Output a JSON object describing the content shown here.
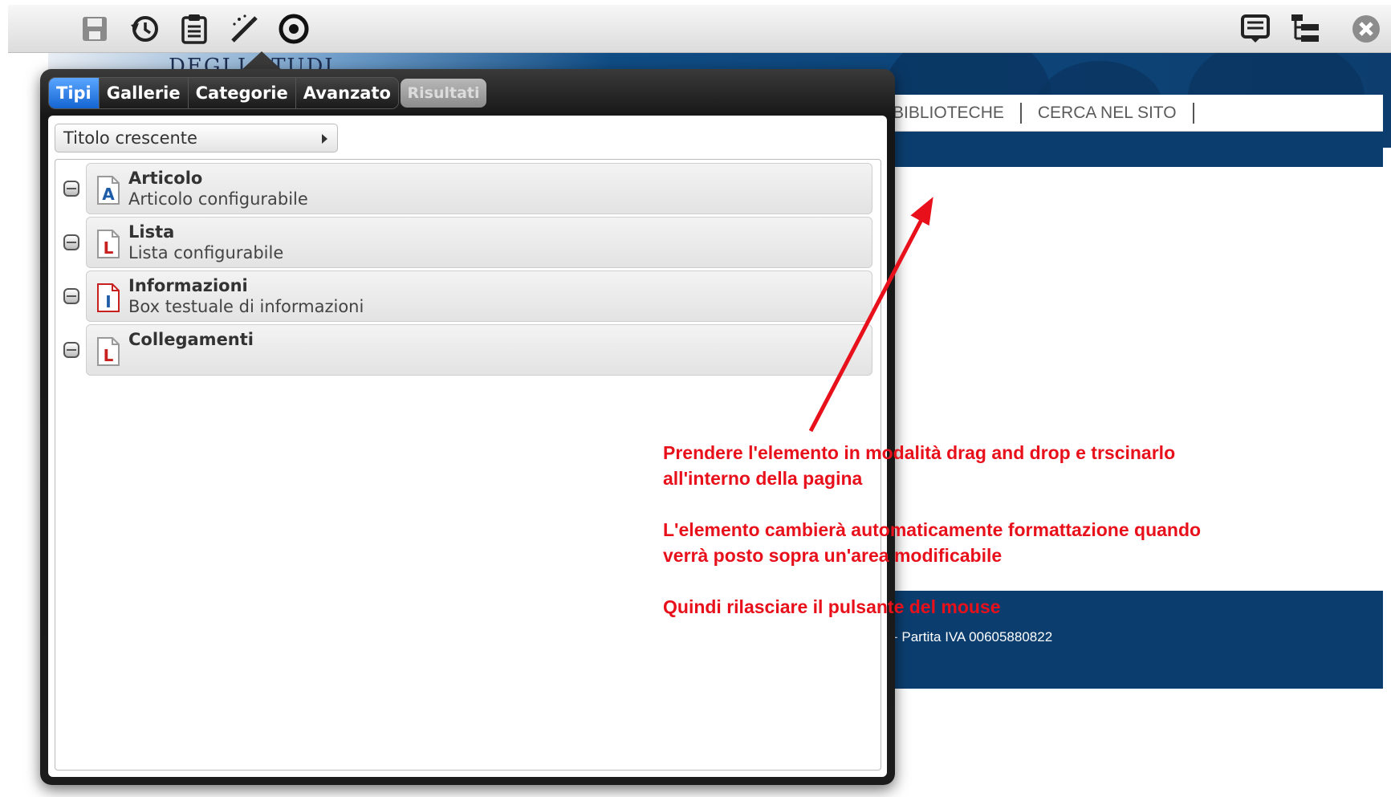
{
  "toolbar": {
    "icons": [
      "save-icon",
      "history-icon",
      "clipboard-icon",
      "magic-wand-icon",
      "target-icon",
      "list-icon",
      "tree-icon",
      "close-icon"
    ]
  },
  "background_page": {
    "logo_text": "DEGLI STUDI",
    "nav": [
      "BIBLIOTECHE",
      "CERCA NEL SITO"
    ],
    "footer": "- Partita IVA 00605880822"
  },
  "dialog": {
    "tabs": [
      {
        "label": "Tipi",
        "active": true
      },
      {
        "label": "Gallerie",
        "active": false
      },
      {
        "label": "Categorie",
        "active": false
      },
      {
        "label": "Avanzato",
        "active": false
      }
    ],
    "results_label": "Risultati",
    "sort_value": "Titolo crescente",
    "items": [
      {
        "title": "Articolo",
        "description": "Articolo configurabile",
        "icon_letter": "A",
        "icon": "article-document-icon"
      },
      {
        "title": "Lista",
        "description": "Lista configurabile",
        "icon_letter": "L",
        "icon": "list-document-icon"
      },
      {
        "title": "Informazioni",
        "description": "Box testuale di informazioni",
        "icon_letter": "I",
        "icon": "info-document-icon"
      },
      {
        "title": "Collegamenti",
        "description": "",
        "icon_letter": "L",
        "icon": "links-document-icon"
      }
    ]
  },
  "annotation": {
    "color": "#e8101a",
    "paragraphs": [
      "Prendere l'elemento in modalità drag and drop e trscinarlo all'interno della pagina",
      "L'elemento cambierà automaticamente formattazione quando verrà posto sopra un'area modificabile",
      "Quindi rilasciare il pulsante del mouse"
    ]
  }
}
